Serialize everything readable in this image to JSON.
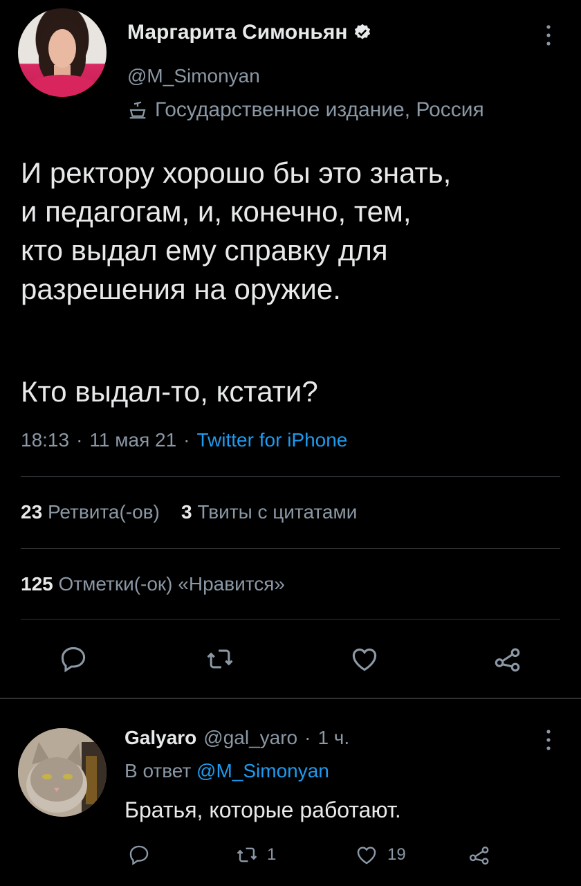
{
  "tweet": {
    "author_name": "Маргарита Симоньян",
    "author_handle": "@M_Simonyan",
    "account_label": "Государственное издание, Россия",
    "text": "И ректору хорошо бы это знать,\nи педагогам, и, конечно, тем,\nкто выдал ему справку для\nразрешения на оружие.",
    "text_question": "Кто выдал-то, кстати?",
    "time": "18:13",
    "date": "11 мая 21",
    "source": "Twitter for iPhone",
    "retweets_count": "23",
    "retweets_label": "Ретвита(-ов)",
    "quotes_count": "3",
    "quotes_label": "Твиты с цитатами",
    "likes_count": "125",
    "likes_label": "Отметки(-ок) «Нравится»"
  },
  "reply": {
    "author_name": "Galyaro",
    "author_handle": "@gal_yaro",
    "time_ago": "1 ч.",
    "reply_to_prefix": "В ответ",
    "reply_to_handle": "@M_Simonyan",
    "text": "Братья, которые работают.",
    "retweets": "1",
    "likes": "19"
  },
  "colors": {
    "background": "#000000",
    "text": "#e7e9ea",
    "muted": "#8b98a5",
    "accent": "#1d9bf0",
    "divider": "#2f3336"
  },
  "icons": [
    "verified-badge-icon",
    "more-options-icon",
    "state-media-icon",
    "reply-icon",
    "retweet-icon",
    "like-icon",
    "share-icon"
  ]
}
